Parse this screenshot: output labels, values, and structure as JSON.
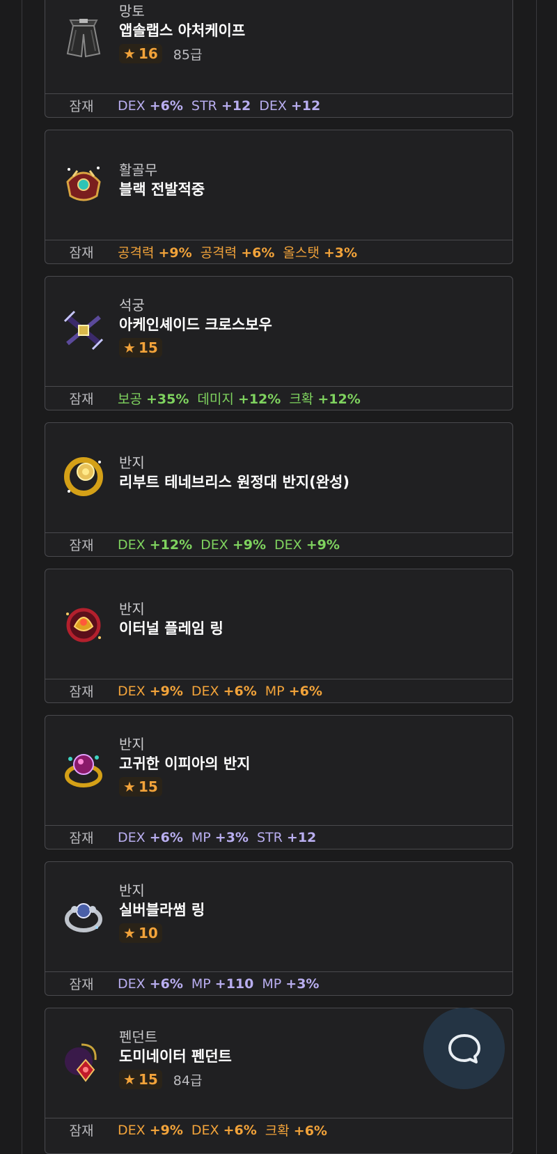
{
  "potential_label": "잠재",
  "items": [
    {
      "category": "망토",
      "name": "앱솔랩스 아처케이프",
      "stars": "16",
      "level": "85급",
      "grade": "c-purple",
      "icon": "cape-icon",
      "stats": [
        {
          "name": "DEX",
          "value": "+6%"
        },
        {
          "name": "STR",
          "value": "+12"
        },
        {
          "name": "DEX",
          "value": "+12"
        }
      ]
    },
    {
      "category": "활골무",
      "name": "블랙 전발적중",
      "stars": "",
      "level": "",
      "grade": "c-orange",
      "icon": "thimble-icon",
      "stats": [
        {
          "name": "공격력",
          "value": "+9%"
        },
        {
          "name": "공격력",
          "value": "+6%"
        },
        {
          "name": "올스탯",
          "value": "+3%"
        }
      ]
    },
    {
      "category": "석궁",
      "name": "아케인셰이드 크로스보우",
      "stars": "15",
      "level": "",
      "grade": "c-green",
      "icon": "crossbow-icon",
      "stats": [
        {
          "name": "보공",
          "value": "+35%"
        },
        {
          "name": "데미지",
          "value": "+12%"
        },
        {
          "name": "크확",
          "value": "+12%"
        }
      ]
    },
    {
      "category": "반지",
      "name": "리부트 테네브리스 원정대 반지(완성)",
      "stars": "",
      "level": "",
      "grade": "c-green",
      "icon": "gold-ring-icon",
      "stats": [
        {
          "name": "DEX",
          "value": "+12%"
        },
        {
          "name": "DEX",
          "value": "+9%"
        },
        {
          "name": "DEX",
          "value": "+9%"
        }
      ]
    },
    {
      "category": "반지",
      "name": "이터널 플레임 링",
      "stars": "",
      "level": "",
      "grade": "c-orange",
      "icon": "flame-ring-icon",
      "stats": [
        {
          "name": "DEX",
          "value": "+9%"
        },
        {
          "name": "DEX",
          "value": "+6%"
        },
        {
          "name": "MP",
          "value": "+6%"
        }
      ]
    },
    {
      "category": "반지",
      "name": "고귀한 이피아의 반지",
      "stars": "15",
      "level": "",
      "grade": "c-purple",
      "icon": "gem-ring-icon",
      "stats": [
        {
          "name": "DEX",
          "value": "+6%"
        },
        {
          "name": "MP",
          "value": "+3%"
        },
        {
          "name": "STR",
          "value": "+12"
        }
      ]
    },
    {
      "category": "반지",
      "name": "실버블라썸 링",
      "stars": "10",
      "level": "",
      "grade": "c-purple",
      "icon": "silver-ring-icon",
      "stats": [
        {
          "name": "DEX",
          "value": "+6%"
        },
        {
          "name": "MP",
          "value": "+110"
        },
        {
          "name": "MP",
          "value": "+3%"
        }
      ]
    },
    {
      "category": "펜던트",
      "name": "도미네이터 펜던트",
      "stars": "15",
      "level": "84급",
      "grade": "c-orange",
      "icon": "pendant-icon",
      "stats": [
        {
          "name": "DEX",
          "value": "+9%"
        },
        {
          "name": "DEX",
          "value": "+6%"
        },
        {
          "name": "크확",
          "value": "+6%"
        }
      ]
    }
  ],
  "chat_button": {
    "icon": "chat-bubble-icon"
  }
}
